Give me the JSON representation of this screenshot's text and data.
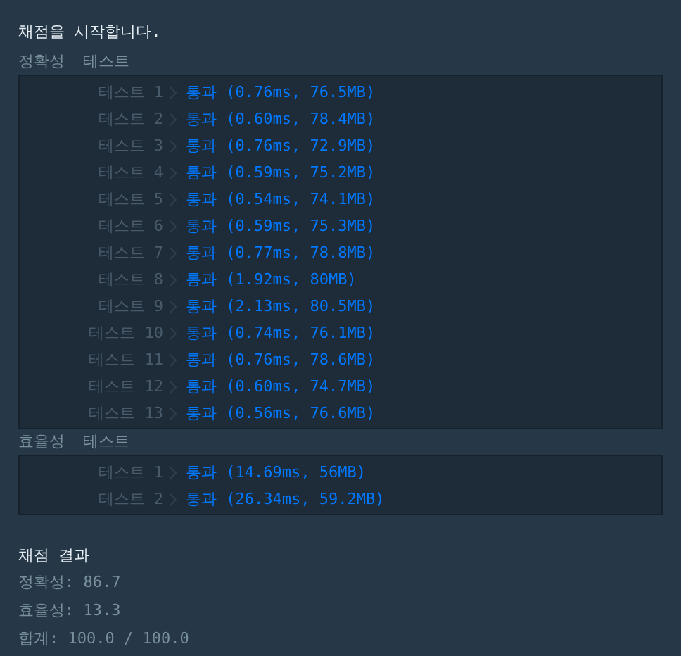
{
  "title": "채점을 시작합니다.",
  "sections": [
    {
      "label": "정확성  테스트",
      "tests": [
        {
          "name": "테스트 1",
          "result": "통과 (0.76ms, 76.5MB)"
        },
        {
          "name": "테스트 2",
          "result": "통과 (0.60ms, 78.4MB)"
        },
        {
          "name": "테스트 3",
          "result": "통과 (0.76ms, 72.9MB)"
        },
        {
          "name": "테스트 4",
          "result": "통과 (0.59ms, 75.2MB)"
        },
        {
          "name": "테스트 5",
          "result": "통과 (0.54ms, 74.1MB)"
        },
        {
          "name": "테스트 6",
          "result": "통과 (0.59ms, 75.3MB)"
        },
        {
          "name": "테스트 7",
          "result": "통과 (0.77ms, 78.8MB)"
        },
        {
          "name": "테스트 8",
          "result": "통과 (1.92ms, 80MB)"
        },
        {
          "name": "테스트 9",
          "result": "통과 (2.13ms, 80.5MB)"
        },
        {
          "name": "테스트 10",
          "result": "통과 (0.74ms, 76.1MB)"
        },
        {
          "name": "테스트 11",
          "result": "통과 (0.76ms, 78.6MB)"
        },
        {
          "name": "테스트 12",
          "result": "통과 (0.60ms, 74.7MB)"
        },
        {
          "name": "테스트 13",
          "result": "통과 (0.56ms, 76.6MB)"
        }
      ]
    },
    {
      "label": "효율성  테스트",
      "tests": [
        {
          "name": "테스트 1",
          "result": "통과 (14.69ms, 56MB)"
        },
        {
          "name": "테스트 2",
          "result": "통과 (26.34ms, 59.2MB)"
        }
      ]
    }
  ],
  "result_heading": "채점 결과",
  "scores": [
    "정확성: 86.7",
    "효율성: 13.3",
    "합계: 100.0 / 100.0"
  ]
}
